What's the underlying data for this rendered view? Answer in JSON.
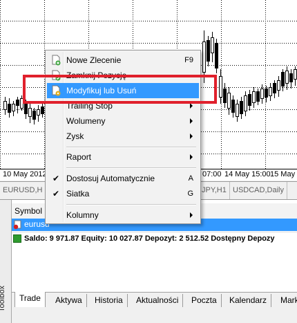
{
  "chart": {
    "time_labels": [
      "10 May 2012",
      "07:00",
      "14 May 15:00",
      "15 May"
    ],
    "tabs": [
      "EURUSD,H",
      "JPY,H1",
      "USDCAD,Daily"
    ]
  },
  "context_menu": {
    "items": [
      {
        "label": "Nowe Zlecenie",
        "shortcut": "F9",
        "icon": "new-order-icon"
      },
      {
        "label": "Zamknij Pozycję",
        "icon": "close-position-icon"
      },
      {
        "label": "Modyfikuj lub Usuń",
        "icon": "modify-order-icon",
        "highlighted": true
      },
      {
        "label": "Trailing Stop",
        "submenu": true
      },
      {
        "label": "Wolumeny",
        "submenu": true
      },
      {
        "label": "Zysk",
        "submenu": true
      },
      {
        "label": "Raport",
        "submenu": true
      },
      {
        "label": "Dostosuj Automatycznie",
        "shortcut": "A",
        "checked": true
      },
      {
        "label": "Siatka",
        "shortcut": "G",
        "checked": true
      },
      {
        "label": "Kolumny",
        "submenu": true
      }
    ]
  },
  "terminal": {
    "column_header": "Symbol",
    "row_symbol": "eurusd",
    "balance_line": "Saldo: 9 971.87  Equity: 10 027.87  Depozyt: 2 512.52  Dostępny Depozy",
    "toolbox_label": "Toolbox",
    "tabs": [
      "Trade",
      "Aktywa",
      "Historia",
      "Aktualności",
      "Poczta",
      "Kalendarz",
      "Mark"
    ],
    "active_tab": "Trade"
  },
  "colors": {
    "highlight": "#3399ff",
    "annotation_box": "#e0202c"
  }
}
